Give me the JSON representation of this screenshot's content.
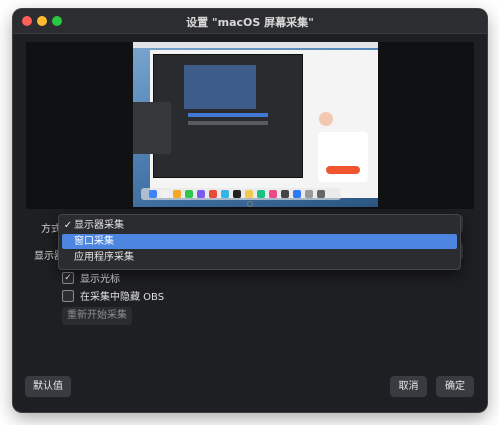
{
  "window": {
    "title": "设置 \"macOS 屏幕采集\""
  },
  "preview": {
    "description_icon": "screen-preview"
  },
  "form": {
    "method_label": "方式",
    "display_label": "显示器",
    "method_dropdown": {
      "options": [
        {
          "label": "显示器采集",
          "checked": true
        },
        {
          "label": "窗口采集",
          "highlighted": true
        },
        {
          "label": "应用程序采集"
        }
      ]
    },
    "show_cursor": {
      "label": "显示光标",
      "checked": true
    },
    "hide_obs": {
      "label": "在采集中隐藏 OBS",
      "checked": false
    },
    "restart_button": "重新开始采集"
  },
  "footer": {
    "defaults_button": "默认值",
    "cancel_button": "取消",
    "ok_button": "确定"
  },
  "colors": {
    "accent": "#4c86e0",
    "window_bg": "#1e1f22",
    "titlebar_bg": "#2c2d30"
  }
}
